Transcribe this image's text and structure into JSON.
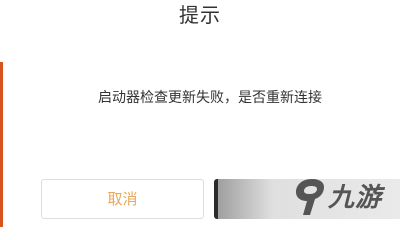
{
  "dialog": {
    "title": "提示",
    "message": "启动器检查更新失败，是否重新连接",
    "cancel_label": "取消",
    "confirm_label": ""
  },
  "watermark": {
    "text": "九游",
    "icon": "jiuyou-logo-icon"
  },
  "colors": {
    "accent_left_edge": "#d8541c",
    "cancel_text": "#e9a85a",
    "confirm_bg": "#2b2b2b",
    "text": "#333333"
  }
}
